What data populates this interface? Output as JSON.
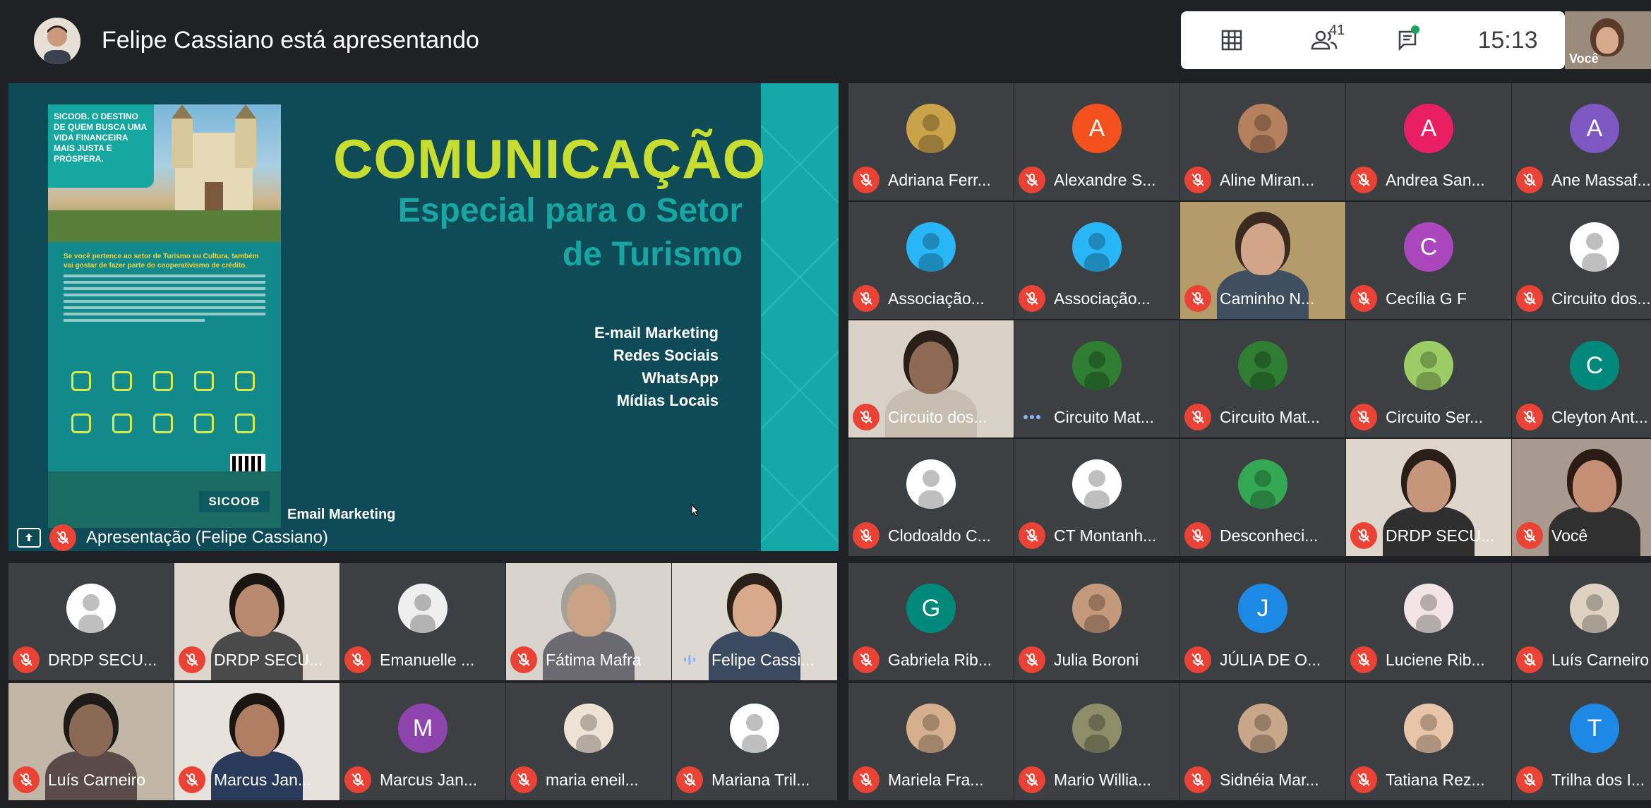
{
  "presenter": {
    "text": "Felipe Cassiano está apresentando"
  },
  "toolbar": {
    "participants_count": "41",
    "time": "15:13",
    "self_label": "Você"
  },
  "slide": {
    "poster_tag": "SICOOB. O DESTINO DE QUEM BUSCA UMA VIDA FINANCEIRA MAIS JUSTA E PRÓSPERA.",
    "poster_head": "Se você pertence ao setor de Turismo ou Cultura, também vai gostar de fazer parte do cooperativismo de crédito.",
    "poster_logo": "SICOOB",
    "title": "COMUNICAÇÃO",
    "subtitle_line1": "Especial para o Setor",
    "subtitle_line2": "de Turismo",
    "list": [
      "E-mail Marketing",
      "Redes Sociais",
      "WhatsApp",
      "Mídias Locais"
    ],
    "caption": "Email Marketing"
  },
  "presentation_label": "Apresentação (Felipe Cassiano)",
  "participants": [
    {
      "name": "Adriana Ferr...",
      "initial": "",
      "avatar_color": "#c9a24a"
    },
    {
      "name": "Alexandre S...",
      "initial": "A",
      "avatar_color": "#f4511e"
    },
    {
      "name": "Aline Miran...",
      "initial": "",
      "avatar_color": "#b5805e"
    },
    {
      "name": "Andrea San...",
      "initial": "A",
      "avatar_color": "#e91e63"
    },
    {
      "name": "Ane Massaf...",
      "initial": "A",
      "avatar_color": "#7e57c2"
    },
    {
      "name": "Associação...",
      "initial": "",
      "avatar_color": "#29b6f6"
    },
    {
      "name": "Associação...",
      "initial": "",
      "avatar_color": "#29b6f6"
    },
    {
      "name": "Caminho N...",
      "initial": "",
      "avatar_color": ""
    },
    {
      "name": "Cecília G F",
      "initial": "C",
      "avatar_color": "#ab47bc"
    },
    {
      "name": "Circuito dos...",
      "initial": "",
      "avatar_color": "#ffffff"
    },
    {
      "name": "Circuito dos...",
      "initial": "",
      "avatar_color": ""
    },
    {
      "name": "Circuito Mat...",
      "initial": "",
      "avatar_color": "#2e7d32"
    },
    {
      "name": "Circuito Mat...",
      "initial": "",
      "avatar_color": "#2e7d32"
    },
    {
      "name": "Circuito Ser...",
      "initial": "",
      "avatar_color": "#9ccc65"
    },
    {
      "name": "Cleyton Ant...",
      "initial": "C",
      "avatar_color": "#00897b"
    },
    {
      "name": "Clodoaldo C...",
      "initial": "",
      "avatar_color": "#ffffff"
    },
    {
      "name": "CT Montanh...",
      "initial": "",
      "avatar_color": "#ffffff"
    },
    {
      "name": "Desconheci...",
      "initial": "",
      "avatar_color": "#34a853"
    },
    {
      "name": "DRDP SECU...",
      "initial": "",
      "avatar_color": ""
    },
    {
      "name": "Você",
      "initial": "",
      "avatar_color": ""
    },
    {
      "name": "DRDP SECU...",
      "initial": "",
      "avatar_color": "#ffffff"
    },
    {
      "name": "DRDP SECU...",
      "initial": "",
      "avatar_color": ""
    },
    {
      "name": "Emanuelle ...",
      "initial": "",
      "avatar_color": "#efefef"
    },
    {
      "name": "Fátima Mafra",
      "initial": "",
      "avatar_color": ""
    },
    {
      "name": "Felipe Cassi...",
      "initial": "",
      "avatar_color": ""
    },
    {
      "name": "Gabriela Rib...",
      "initial": "G",
      "avatar_color": "#00897b"
    },
    {
      "name": "Julia Boroni",
      "initial": "",
      "avatar_color": "#c49a7a"
    },
    {
      "name": "JÚLIA DE O...",
      "initial": "J",
      "avatar_color": "#1e88e5"
    },
    {
      "name": "Luciene Rib...",
      "initial": "",
      "avatar_color": "#f3e5e5"
    },
    {
      "name": "Luís Carneiro",
      "initial": "",
      "avatar_color": "#e0d2c2"
    },
    {
      "name": "Luís Carneiro",
      "initial": "",
      "avatar_color": ""
    },
    {
      "name": "Marcus Jan...",
      "initial": "",
      "avatar_color": ""
    },
    {
      "name": "Marcus Jan...",
      "initial": "M",
      "avatar_color": "#8e44ad"
    },
    {
      "name": "maria eneil...",
      "initial": "",
      "avatar_color": "#efe3d6"
    },
    {
      "name": "Mariana Tril...",
      "initial": "",
      "avatar_color": "#ffffff"
    },
    {
      "name": "Mariela Fra...",
      "initial": "",
      "avatar_color": "#d6b08c"
    },
    {
      "name": "Mario Willia...",
      "initial": "",
      "avatar_color": "#8d8d6a"
    },
    {
      "name": "Sidnéia Mar...",
      "initial": "",
      "avatar_color": "#c9a78a"
    },
    {
      "name": "Tatiana Rez...",
      "initial": "",
      "avatar_color": "#e8c4a8"
    },
    {
      "name": "Trilha dos I...",
      "initial": "T",
      "avatar_color": "#1e88e5"
    }
  ]
}
